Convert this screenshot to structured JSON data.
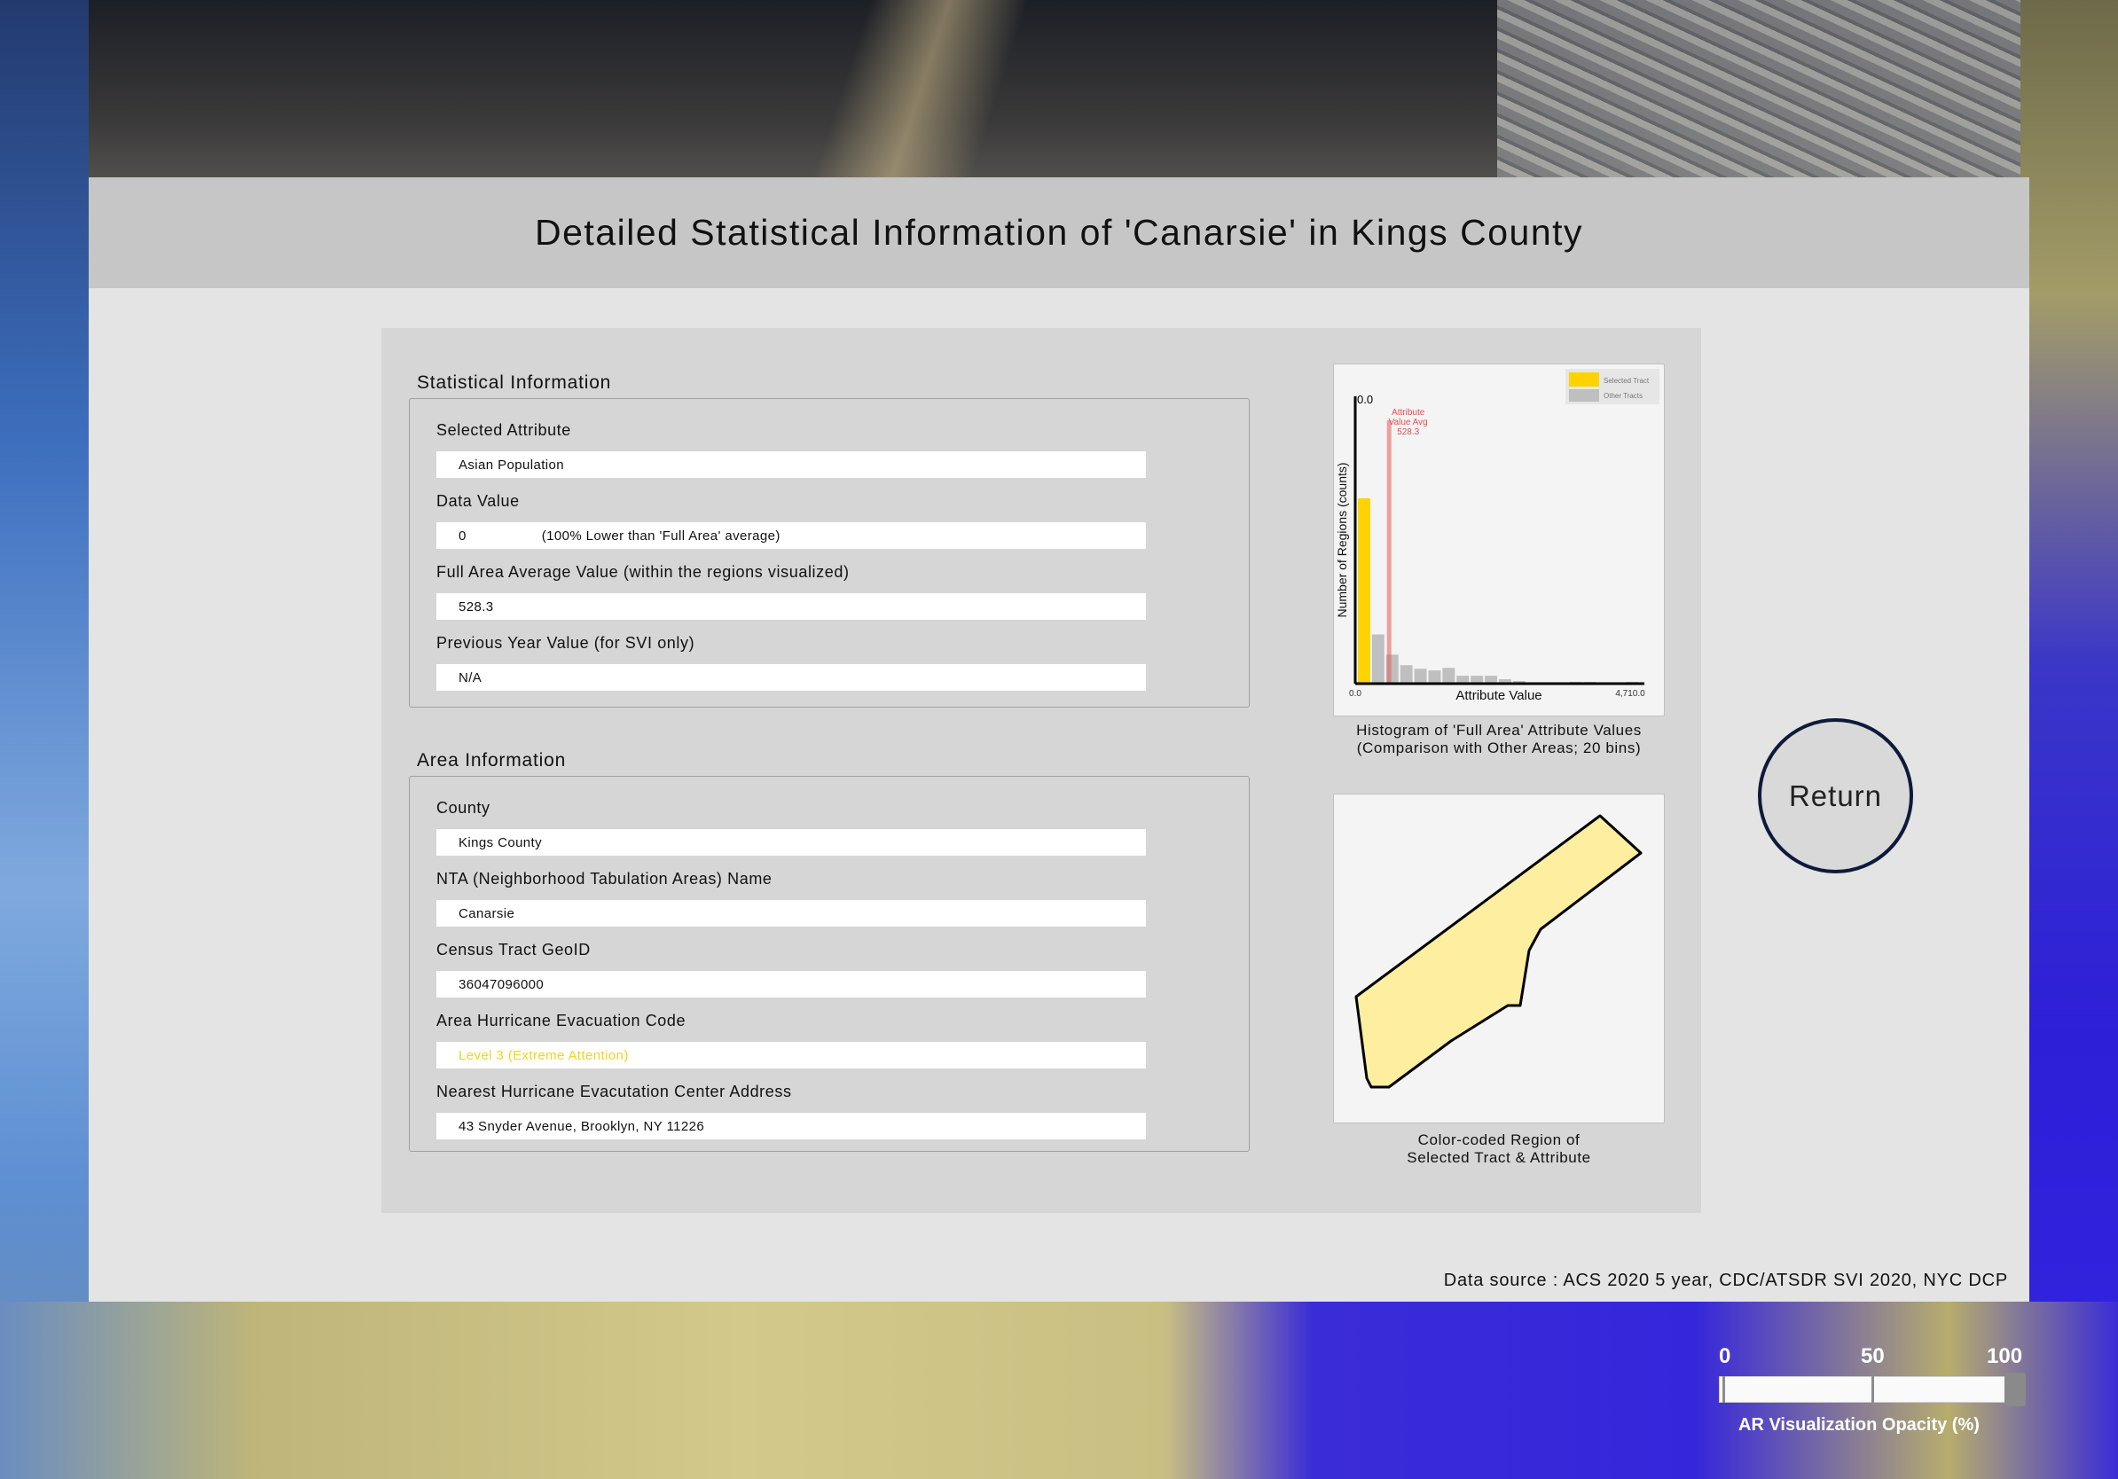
{
  "panel": {
    "title": "Detailed Statistical Information of 'Canarsie' in Kings County",
    "data_source": "Data source : ACS 2020 5 year, CDC/ATSDR SVI 2020, NYC DCP",
    "return_label": "Return"
  },
  "statistical": {
    "heading": "Statistical Information",
    "selected_attribute_label": "Selected Attribute",
    "selected_attribute_value": "Asian Population",
    "data_value_label": "Data Value",
    "data_value": "0",
    "data_value_note": "(100% Lower than 'Full Area' average)",
    "full_avg_label": "Full Area Average Value (within the regions visualized)",
    "full_avg_value": "528.3",
    "prev_year_label": "Previous Year Value (for SVI only)",
    "prev_year_value": "N/A"
  },
  "area": {
    "heading": "Area Information",
    "county_label": "County",
    "county_value": "Kings County",
    "nta_label": "NTA (Neighborhood Tabulation Areas) Name",
    "nta_value": "Canarsie",
    "geoid_label": "Census Tract GeoID",
    "geoid_value": "36047096000",
    "evac_code_label": "Area Hurricane Evacuation Code",
    "evac_code_value": "Level 3 (Extreme Attention)",
    "evac_center_label": "Nearest Hurricane Evacutation Center Address",
    "evac_center_value": "43 Snyder Avenue, Brooklyn, NY 11226"
  },
  "histogram": {
    "caption_line1": "Histogram of 'Full Area' Attribute Values",
    "caption_line2": "(Comparison with Other Areas; 20 bins)"
  },
  "chart_data": {
    "type": "bar",
    "xlabel": "Attribute Value",
    "ylabel": "Number of Regions (counts)",
    "x_min_label": "0.0",
    "x_max_label": "4,710.0",
    "xlim": [
      0,
      4710
    ],
    "selected_bar_label": "0.0",
    "legend": [
      "Selected Tract",
      "Other Tracts"
    ],
    "legend_placement": "top-right",
    "avg_line": {
      "label_lines": [
        "Attribute",
        "Value Avg",
        "528.3"
      ],
      "value": 528.3
    },
    "bins": 20,
    "series": [
      {
        "name": "Selected Tract",
        "color": "#ffd200",
        "values": [
          210,
          0,
          0,
          0,
          0,
          0,
          0,
          0,
          0,
          0,
          0,
          0,
          0,
          0,
          0,
          0,
          0,
          0,
          0,
          0
        ]
      },
      {
        "name": "Other Tracts",
        "color": "#bfbfbf",
        "values": [
          0,
          55,
          32,
          20,
          16,
          14,
          17,
          8,
          8,
          8,
          4,
          2,
          0,
          0,
          0,
          1,
          1,
          0,
          0,
          1
        ]
      }
    ]
  },
  "region": {
    "caption_line1": "Color-coded Region of",
    "caption_line2": "Selected Tract & Attribute",
    "fill": "#fdeea0"
  },
  "slider": {
    "label_0": "0",
    "label_50": "50",
    "label_100": "100",
    "title": "AR Visualization Opacity (%)",
    "value": 100
  }
}
